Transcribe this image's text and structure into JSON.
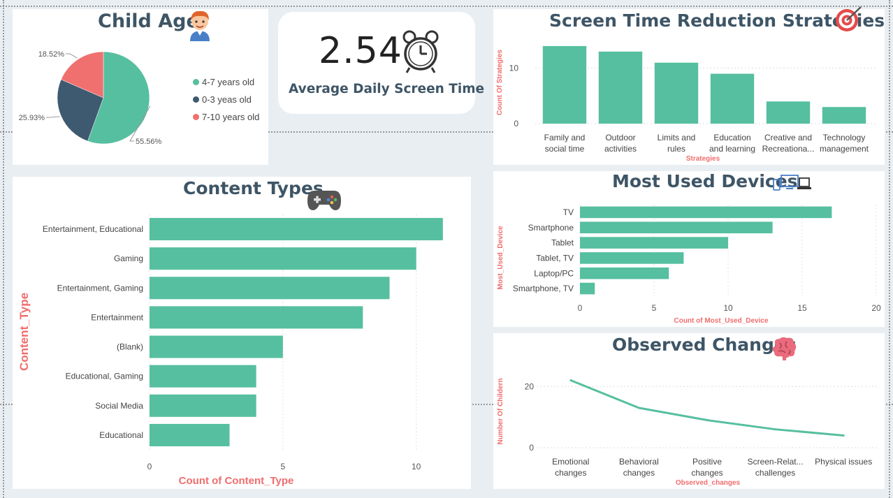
{
  "colors": {
    "teal": "#56bf9f",
    "navy": "#3e5a70",
    "coral": "#f07070",
    "title": "#3e5566",
    "axis_title": "#f06d6d"
  },
  "child_age": {
    "title": "Child Age",
    "icon": "boy-avatar-icon",
    "legend": [
      "4-7 years old",
      "0-3 yeas old",
      "7-10 years old"
    ],
    "chart_data": {
      "type": "pie",
      "labels": [
        "4-7 years old",
        "0-3 yeas old",
        "7-10 years old"
      ],
      "values": [
        55.56,
        25.93,
        18.52
      ],
      "value_labels": [
        "55.56%",
        "25.93%",
        "18.52%"
      ],
      "colors": [
        "#56bf9f",
        "#3e5a70",
        "#f07070"
      ],
      "legend_position": "right"
    }
  },
  "kpi": {
    "value": "2.54",
    "label": "Average Daily Screen Time",
    "icon": "alarm-clock-icon"
  },
  "strategies": {
    "title": "Screen Time Reduction Strategies",
    "icon": "target-icon",
    "chart_data": {
      "type": "bar",
      "categories": [
        [
          "Family and",
          "social time"
        ],
        [
          "Outdoor",
          "activities"
        ],
        [
          "Limits and",
          "rules"
        ],
        [
          "Education",
          "and learning"
        ],
        [
          "Creative and",
          "Recreationa..."
        ],
        [
          "Technology",
          "management"
        ]
      ],
      "values": [
        14,
        13,
        11,
        9,
        4,
        3
      ],
      "xlabel": "Strategies",
      "ylabel": "Count Of Strategies",
      "yticks": [
        0,
        10
      ],
      "ylim": [
        0,
        15
      ],
      "grid": true
    }
  },
  "content_types": {
    "title": "Content Types",
    "icon": "gamepad-icon",
    "chart_data": {
      "type": "bar",
      "orientation": "horizontal",
      "categories": [
        "Entertainment, Educational",
        "Gaming",
        "Entertainment, Gaming",
        "Entertainment",
        "(Blank)",
        "Educational, Gaming",
        "Social Media",
        "Educational"
      ],
      "values": [
        11,
        10,
        9,
        8,
        5,
        4,
        4,
        3
      ],
      "xlabel": "Count of Content_Type",
      "ylabel": "Content_Type",
      "xticks": [
        0,
        5,
        10
      ],
      "xlim": [
        0,
        12
      ],
      "grid": true
    }
  },
  "devices": {
    "title": "Most Used Devices",
    "icon": "devices-icon",
    "chart_data": {
      "type": "bar",
      "orientation": "horizontal",
      "categories": [
        "TV",
        "Smartphone",
        "Tablet",
        "Tablet, TV",
        "Laptop/PC",
        "Smartphone, TV"
      ],
      "values": [
        17,
        13,
        10,
        7,
        6,
        1
      ],
      "xlabel": "Count of Most_Used_Device",
      "ylabel": "Most_Used_Device",
      "xticks": [
        0,
        5,
        10,
        15,
        20
      ],
      "xlim": [
        0,
        20
      ],
      "grid": true
    }
  },
  "changes": {
    "title": "Observed Changes",
    "icon": "brain-icon",
    "chart_data": {
      "type": "line",
      "categories": [
        [
          "Emotional",
          "changes"
        ],
        [
          "Behavioral",
          "changes"
        ],
        [
          "Positive",
          "changes"
        ],
        [
          "Screen-Relat...",
          "challenges"
        ],
        [
          "Physical issues"
        ]
      ],
      "values": [
        22,
        13,
        9,
        6,
        4
      ],
      "xlabel": "Observed_changes",
      "ylabel": "Number Of Childern",
      "yticks": [
        0,
        20
      ],
      "ylim": [
        0,
        26
      ],
      "grid": true
    }
  }
}
